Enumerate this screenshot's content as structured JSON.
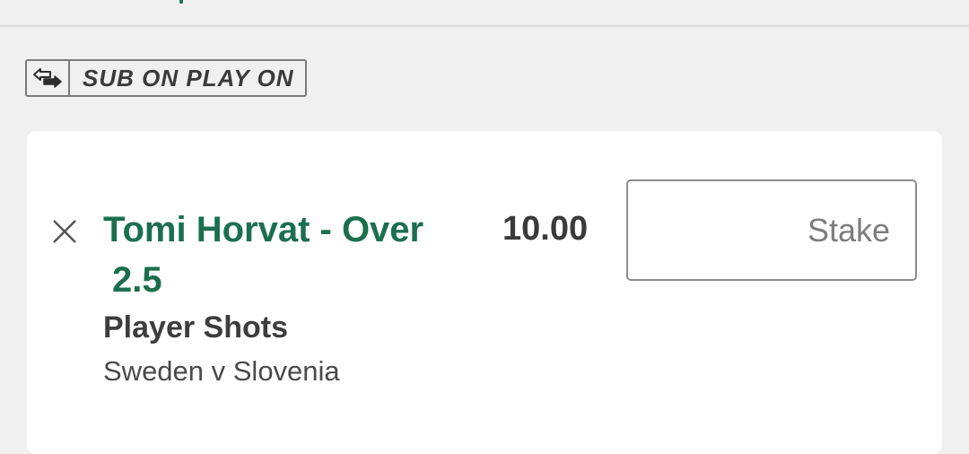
{
  "promo": {
    "label": "SUB ON PLAY ON",
    "icon": "substitution-arrows-icon"
  },
  "bet_slip": {
    "selection_line1": "Tomi Horvat - Over",
    "selection_line2": "2.5",
    "market": "Player Shots",
    "event": "Sweden v Slovenia",
    "odds": "10.00",
    "stake": {
      "value": "",
      "placeholder": "Stake"
    },
    "remove_icon": "close-icon"
  },
  "colors": {
    "background": "#f0f0f0",
    "card": "#ffffff",
    "brand_green": "#1b6f4e",
    "text_dark": "#3a3a3a",
    "border_grey": "#8c8c8c"
  }
}
